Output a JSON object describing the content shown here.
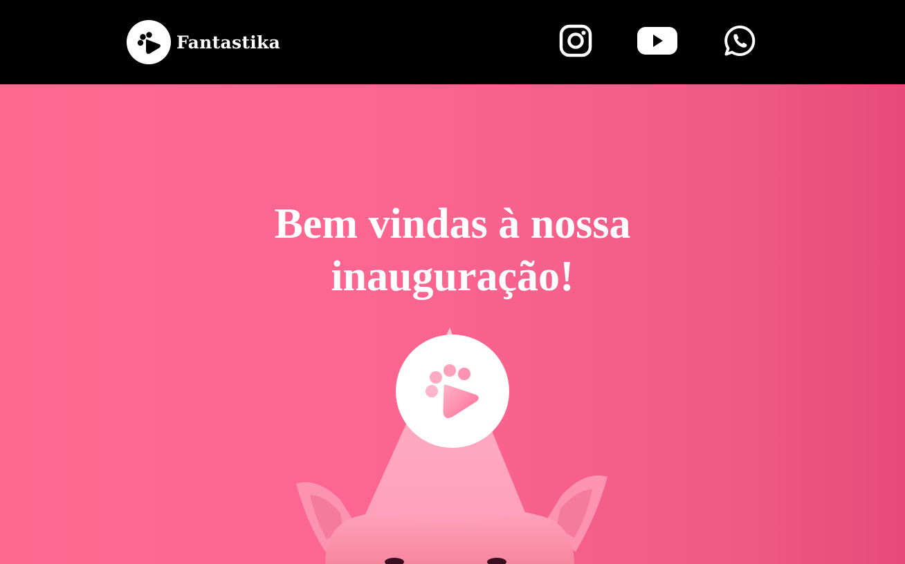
{
  "header": {
    "brand_name": "Fantastika",
    "social": [
      {
        "name": "instagram",
        "icon": "instagram-icon"
      },
      {
        "name": "youtube",
        "icon": "youtube-icon"
      },
      {
        "name": "whatsapp",
        "icon": "whatsapp-icon"
      }
    ]
  },
  "hero": {
    "title_line1": "Bem vindas à nossa",
    "title_line2": "inauguração!",
    "badge_icon": "paw-play-icon",
    "image": "dog-with-party-hat"
  },
  "colors": {
    "header_bg": "#000000",
    "hero_bg": "#fb6590",
    "accent": "#ff7aa0",
    "text": "#ffffff"
  }
}
